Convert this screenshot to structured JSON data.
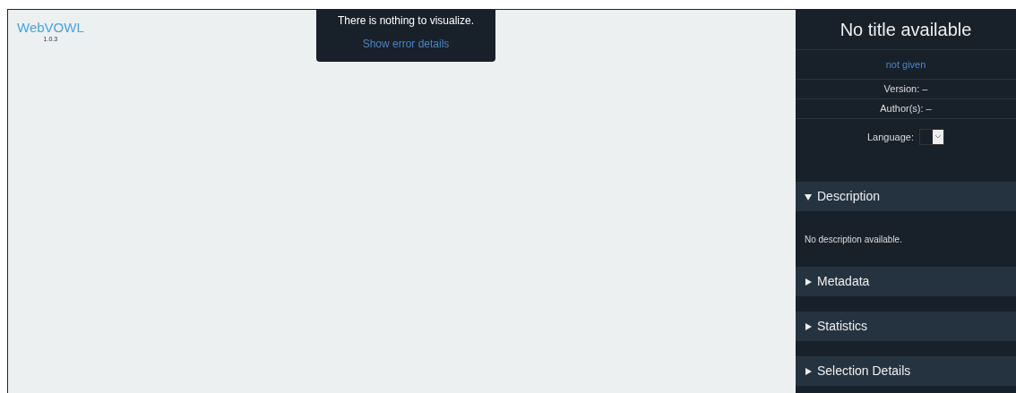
{
  "logo": {
    "title": "WebVOWL",
    "version": "1.0.3"
  },
  "notification": {
    "message": "There is nothing to visualize.",
    "link": "Show error details"
  },
  "sidebar": {
    "title": "No title available",
    "iri": "not given",
    "version": "Version: –",
    "authors": "Author(s): –",
    "language_label": "Language:",
    "sections": [
      {
        "title": "Description",
        "expanded": true,
        "body": "No description available."
      },
      {
        "title": "Metadata",
        "expanded": false
      },
      {
        "title": "Statistics",
        "expanded": false
      },
      {
        "title": "Selection Details",
        "expanded": false
      }
    ]
  }
}
